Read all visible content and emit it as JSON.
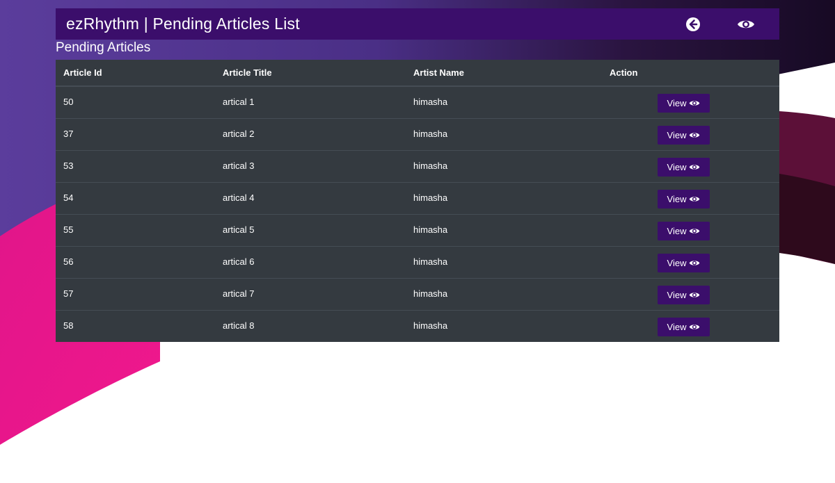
{
  "header": {
    "title": "ezRhythm | Pending Articles List",
    "back_icon": "arrow-left-circle-icon",
    "view_icon": "eye-icon"
  },
  "section_title": "Pending Articles",
  "table": {
    "columns": [
      "Article Id",
      "Article Title",
      "Artist Name",
      "Action"
    ],
    "rows": [
      {
        "id": "50",
        "title": "artical 1",
        "artist": "himasha",
        "action": "View"
      },
      {
        "id": "37",
        "title": "artical 2",
        "artist": "himasha",
        "action": "View"
      },
      {
        "id": "53",
        "title": "artical 3",
        "artist": "himasha",
        "action": "View"
      },
      {
        "id": "54",
        "title": "artical 4",
        "artist": "himasha",
        "action": "View"
      },
      {
        "id": "55",
        "title": "artical 5",
        "artist": "himasha",
        "action": "View"
      },
      {
        "id": "56",
        "title": "artical 6",
        "artist": "himasha",
        "action": "View"
      },
      {
        "id": "57",
        "title": "artical 7",
        "artist": "himasha",
        "action": "View"
      },
      {
        "id": "58",
        "title": "artical 8",
        "artist": "himasha",
        "action": "View"
      }
    ]
  },
  "colors": {
    "brand": "#3b0e6b",
    "table_bg": "#343a40",
    "table_border": "#454d55",
    "bg_purple": "#5b3d9c",
    "bg_pink": "#e6168a",
    "bg_dark": "#1a0a28",
    "bg_maroon": "#5c1038"
  }
}
